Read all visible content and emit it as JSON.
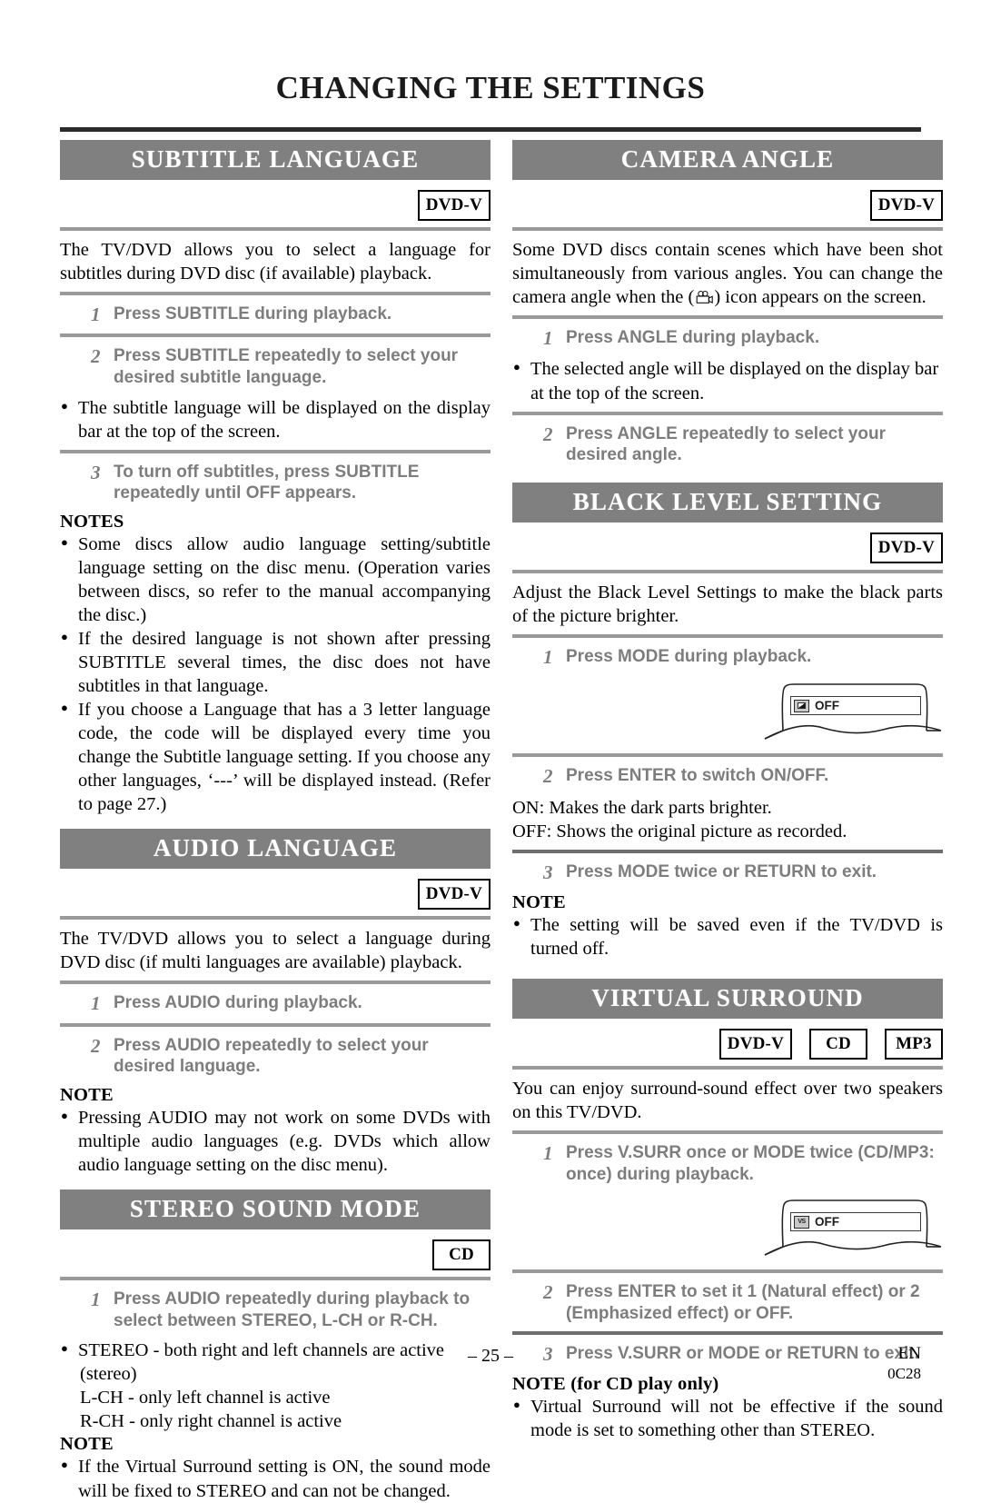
{
  "document": {
    "title": "CHANGING THE SETTINGS",
    "page_number": "– 25 –",
    "footer_lang": "EN",
    "footer_code": "0C28"
  },
  "colors": {
    "header_bar": "#808080",
    "rule": "#9a9a9a",
    "step_text": "#7d7d7d",
    "title_rule": "#2b2b2b"
  },
  "left_column": {
    "subtitle_language": {
      "heading": "SUBTITLE LANGUAGE",
      "badges": [
        "DVD-V"
      ],
      "intro": "The TV/DVD allows you to select a language for subtitles during DVD disc (if available) playback.",
      "steps": [
        {
          "num": "1",
          "text": "Press SUBTITLE during playback."
        },
        {
          "num": "2",
          "text": "Press SUBTITLE repeatedly to select your desired subtitle language."
        },
        {
          "num": "3",
          "text": "To turn off subtitles, press SUBTITLE repeatedly until OFF appears."
        }
      ],
      "after_step2_bullet": "The subtitle language will be displayed on the display bar at the top of the screen.",
      "notes_heading": "NOTES",
      "notes": [
        "Some discs allow audio language setting/subtitle language setting on the disc menu. (Operation varies between discs, so refer to the manual accompanying the disc.)",
        "If the desired language is not shown after pressing SUBTITLE several times, the disc does not have subtitles in that language.",
        "If you choose a Language that has a 3 letter language code, the code will be displayed every time you change the Subtitle language setting. If you choose any other languages, ‘---’ will be displayed instead. (Refer to page 27.)"
      ]
    },
    "audio_language": {
      "heading": "AUDIO LANGUAGE",
      "badges": [
        "DVD-V"
      ],
      "intro": "The TV/DVD allows you to select a language during DVD disc (if multi languages are available) playback.",
      "steps": [
        {
          "num": "1",
          "text": "Press AUDIO during playback."
        },
        {
          "num": "2",
          "text": "Press AUDIO repeatedly to select your desired language."
        }
      ],
      "notes_heading": "NOTE",
      "notes": [
        "Pressing AUDIO may not work on some DVDs with multiple audio languages (e.g. DVDs which allow audio language setting on the disc menu)."
      ]
    },
    "stereo_sound_mode": {
      "heading": "STEREO SOUND MODE",
      "badges": [
        "CD"
      ],
      "steps": [
        {
          "num": "1",
          "text": "Press AUDIO repeatedly during playback to select between STEREO, L-CH or R-CH."
        }
      ],
      "mode_bullet_line1": "STEREO - both right and left channels are active",
      "mode_lines": [
        "(stereo)",
        "L-CH - only left channel is active",
        "R-CH - only right channel is active"
      ],
      "notes_heading": "NOTE",
      "notes": [
        "If the Virtual Surround setting is ON, the sound mode will be fixed to STEREO and can not be changed."
      ]
    }
  },
  "right_column": {
    "camera_angle": {
      "heading": "CAMERA ANGLE",
      "badges": [
        "DVD-V"
      ],
      "intro_part1": "Some DVD discs contain scenes which have been shot simultaneously from various angles. You can change the camera angle when the (",
      "intro_part2": ") icon appears on the screen.",
      "icon_name": "movie-camera-icon",
      "steps": [
        {
          "num": "1",
          "text": "Press ANGLE during playback."
        },
        {
          "num": "2",
          "text": "Press ANGLE repeatedly to select your desired angle."
        }
      ],
      "after_step1_bullet": "The selected angle will be displayed on the display bar at the top of the screen."
    },
    "black_level_setting": {
      "heading": "BLACK LEVEL SETTING",
      "badges": [
        "DVD-V"
      ],
      "intro": "Adjust the Black Level Settings to make the black parts of the picture brighter.",
      "steps": [
        {
          "num": "1",
          "text": "Press MODE during playback."
        },
        {
          "num": "2",
          "text": "Press ENTER to switch ON/OFF."
        },
        {
          "num": "3",
          "text": "Press MODE twice or RETURN to exit."
        }
      ],
      "osd": {
        "icon_name": "black-level-icon",
        "value": "OFF"
      },
      "on_line": "ON: Makes the dark parts brighter.",
      "off_line": "OFF: Shows the original picture as recorded.",
      "notes_heading": "NOTE",
      "notes": [
        "The setting will be saved even if the TV/DVD is turned off."
      ]
    },
    "virtual_surround": {
      "heading": "VIRTUAL SURROUND",
      "badges": [
        "DVD-V",
        "CD",
        "MP3"
      ],
      "intro": "You can enjoy surround-sound effect over two speakers on this TV/DVD.",
      "steps": [
        {
          "num": "1",
          "text": "Press V.SURR once or MODE twice (CD/MP3: once) during playback."
        },
        {
          "num": "2",
          "text": "Press ENTER to set it 1 (Natural effect) or 2 (Emphasized effect) or OFF."
        },
        {
          "num": "3",
          "text": "Press V.SURR or MODE or RETURN to exit."
        }
      ],
      "osd": {
        "icon_name": "virtual-surround-icon",
        "value": "OFF",
        "glyph": "VS"
      },
      "notes_heading": "NOTE (for CD play only)",
      "notes": [
        "Virtual Surround will not be effective if the sound mode is set to something other than STEREO."
      ]
    }
  }
}
